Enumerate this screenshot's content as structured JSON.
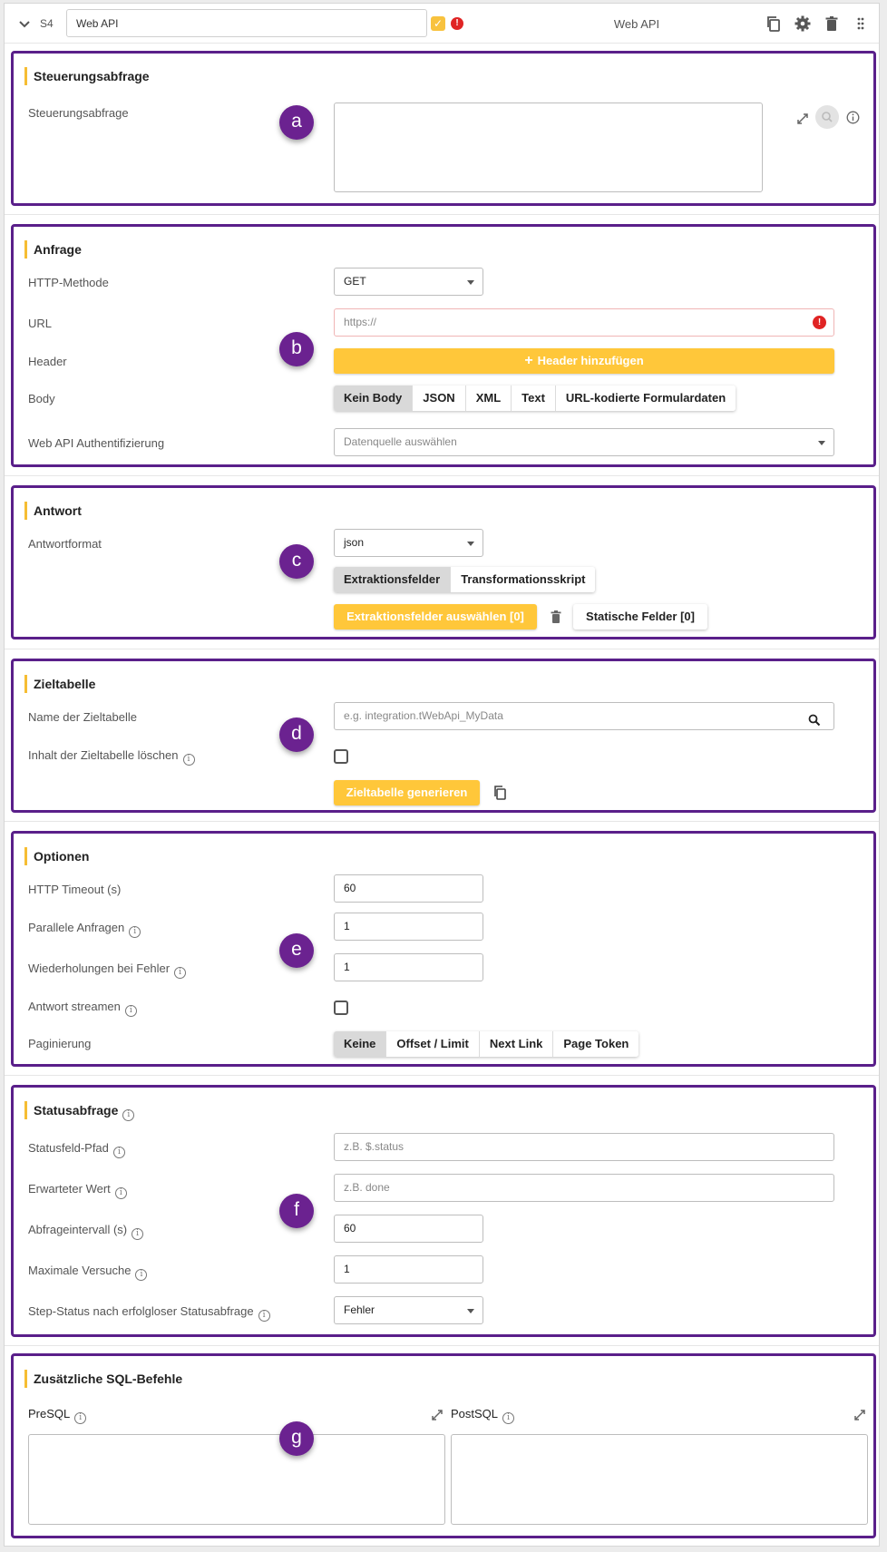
{
  "header": {
    "step_id": "S4",
    "step_name": "Web API",
    "title": "Web API",
    "icons": [
      "chevron-down-icon",
      "check-icon",
      "error-icon",
      "copy-icon",
      "gear-icon",
      "trash-icon",
      "drag-handle-icon"
    ]
  },
  "markers": [
    "a",
    "b",
    "c",
    "d",
    "e",
    "f",
    "g"
  ],
  "sections": {
    "steuerung": {
      "title": "Steuerungsabfrage",
      "label": "Steuerungsabfrage",
      "value": ""
    },
    "anfrage": {
      "title": "Anfrage",
      "method_label": "HTTP-Methode",
      "method_value": "GET",
      "url_label": "URL",
      "url_placeholder": "https://",
      "header_label": "Header",
      "header_button": "Header hinzufügen",
      "body_label": "Body",
      "body_options": [
        "Kein Body",
        "JSON",
        "XML",
        "Text",
        "URL-kodierte Formulardaten"
      ],
      "body_selected": "Kein Body",
      "auth_label": "Web API Authentifizierung",
      "auth_placeholder": "Datenquelle auswählen"
    },
    "antwort": {
      "title": "Antwort",
      "format_label": "Antwortformat",
      "format_value": "json",
      "mode_options": [
        "Extraktionsfelder",
        "Transformationsskript"
      ],
      "mode_selected": "Extraktionsfelder",
      "select_fields_button": "Extraktionsfelder auswählen [0]",
      "static_fields_button": "Statische Felder [0]"
    },
    "ziel": {
      "title": "Zieltabelle",
      "name_label": "Name der Zieltabelle",
      "name_placeholder": "e.g. integration.tWebApi_MyData",
      "clear_label": "Inhalt der Zieltabelle löschen",
      "clear_checked": false,
      "generate_button": "Zieltabelle generieren"
    },
    "optionen": {
      "title": "Optionen",
      "timeout_label": "HTTP Timeout (s)",
      "timeout_value": "60",
      "parallel_label": "Parallele Anfragen",
      "parallel_value": "1",
      "retries_label": "Wiederholungen bei Fehler",
      "retries_value": "1",
      "stream_label": "Antwort streamen",
      "stream_checked": false,
      "paging_label": "Paginierung",
      "paging_options": [
        "Keine",
        "Offset / Limit",
        "Next Link",
        "Page Token"
      ],
      "paging_selected": "Keine"
    },
    "status": {
      "title": "Statusabfrage",
      "path_label": "Statusfeld-Pfad",
      "path_placeholder": "z.B. $.status",
      "expected_label": "Erwarteter Wert",
      "expected_placeholder": "z.B. done",
      "interval_label": "Abfrageintervall (s)",
      "interval_value": "60",
      "max_label": "Maximale Versuche",
      "max_value": "1",
      "failstatus_label": "Step-Status nach erfolgloser Statusabfrage",
      "failstatus_value": "Fehler"
    },
    "sql": {
      "title": "Zusätzliche SQL-Befehle",
      "presql_label": "PreSQL",
      "postsql_label": "PostSQL"
    }
  },
  "colors": {
    "accent": "#ffc73a",
    "marker": "#6b2290",
    "section_border": "#5a1f8a",
    "error": "#e02424"
  }
}
